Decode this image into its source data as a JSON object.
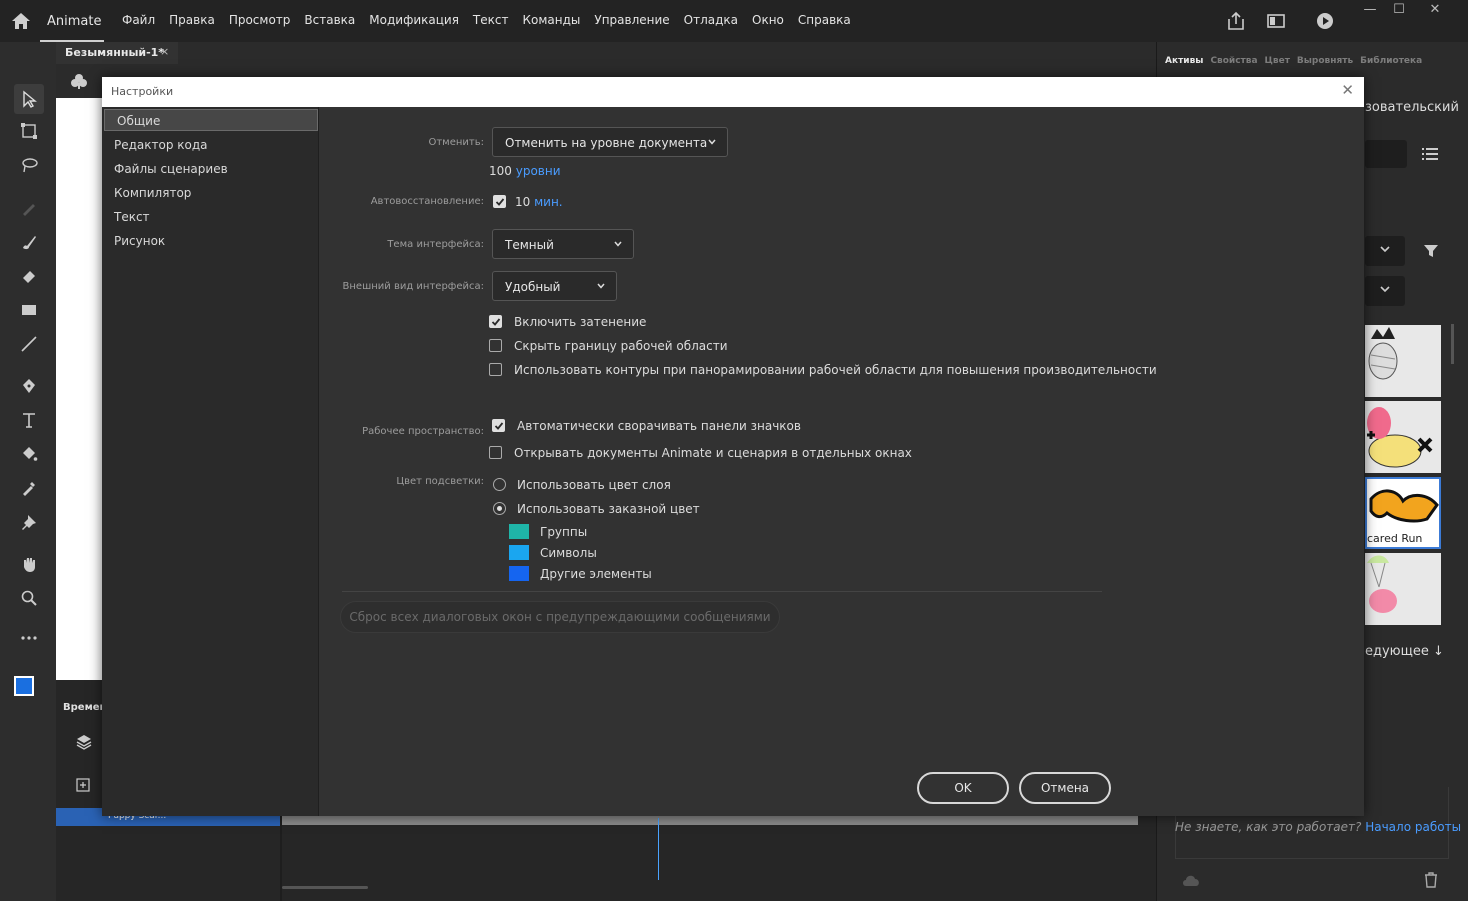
{
  "app": {
    "name": "Animate",
    "menu": [
      "Файл",
      "Правка",
      "Просмотр",
      "Вставка",
      "Модификация",
      "Текст",
      "Команды",
      "Управление",
      "Отладка",
      "Окно",
      "Справка"
    ]
  },
  "document_tab": {
    "title": "Безымянный-1*",
    "close_glyph": "×"
  },
  "timeline": {
    "label": "Времени",
    "layer_name": "Puppy Scar..."
  },
  "right_panel": {
    "tabs": [
      "Активы",
      "Свойства",
      "Цвет",
      "Выровнять",
      "Библиотека"
    ],
    "user_label": "зовательский",
    "thumbnail_label": "cared Run",
    "next_label": "едующее",
    "help_text": "Не знаете, как это работает?",
    "help_link": "Начало работы"
  },
  "dialog": {
    "title": "Настройки",
    "close_glyph": "✕",
    "categories": [
      "Общие",
      "Редактор кода",
      "Файлы сценариев",
      "Компилятор",
      "Текст",
      "Рисунок"
    ],
    "selected_category": "Общие",
    "undo": {
      "label": "Отменить:",
      "value": "Отменить на уровне документа",
      "levels_value": "100",
      "levels_unit": "уровни"
    },
    "autorecovery": {
      "label": "Автовосстановление:",
      "checked": true,
      "value": "10",
      "unit": "мин."
    },
    "theme": {
      "label": "Тема интерфейса:",
      "value": "Темный"
    },
    "appearance": {
      "label": "Внешний вид интерфейса:",
      "value": "Удобный"
    },
    "options": [
      {
        "label": "Включить затенение",
        "checked": true
      },
      {
        "label": "Скрыть границу рабочей области",
        "checked": false
      },
      {
        "label": "Использовать контуры при панорамировании рабочей области для повышения производительности",
        "checked": false
      }
    ],
    "workspace": {
      "label": "Рабочее пространство:",
      "options": [
        {
          "label": "Автоматически сворачивать панели значков",
          "checked": true
        },
        {
          "label": "Открывать документы Animate и сценария в отдельных окнах",
          "checked": false
        }
      ]
    },
    "highlight": {
      "label": "Цвет подсветки:",
      "options": [
        {
          "label": "Использовать цвет слоя",
          "selected": false
        },
        {
          "label": "Использовать заказной цвет",
          "selected": true
        }
      ],
      "swatches": [
        {
          "label": "Группы",
          "color": "#1fb5a8"
        },
        {
          "label": "Символы",
          "color": "#1aa6f0"
        },
        {
          "label": "Другие элементы",
          "color": "#1565f0"
        }
      ]
    },
    "reset_button": "Сброс всех диалоговых окон с предупреждающими сообщениями",
    "ok_button": "OK",
    "cancel_button": "Отмена"
  },
  "colors": {
    "fill_color": "#1a6fe0",
    "accent_link": "#4a9cff"
  }
}
